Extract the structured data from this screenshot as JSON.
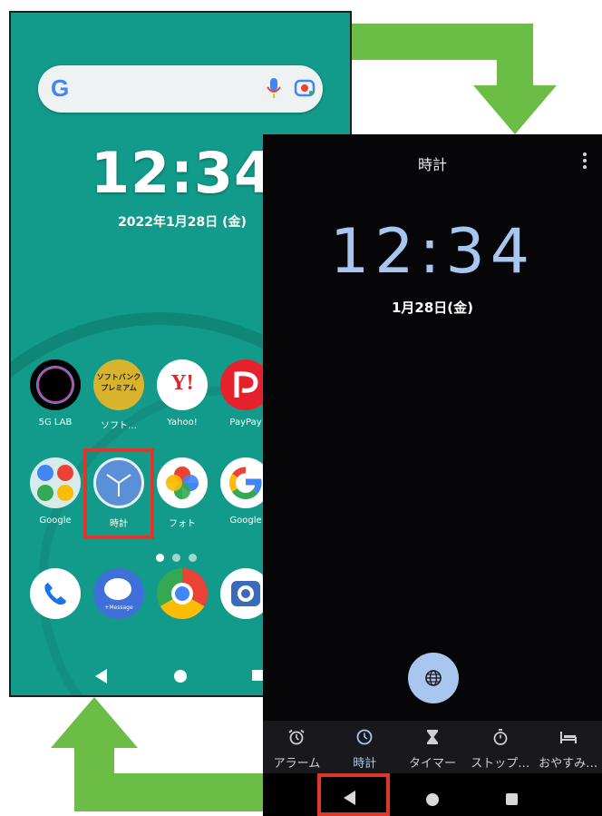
{
  "home_screen": {
    "time": "12:34",
    "date": "2022年1月28日 (金)",
    "search_icons": [
      "google-g-icon",
      "microphone-icon",
      "google-lens-icon"
    ],
    "apps": [
      {
        "label": "5G LAB",
        "icon": "5g-lab-icon"
      },
      {
        "label": "ソフト…",
        "icon": "softbank-premium-icon",
        "icon_text": "ソフトバンク\nプレミアム"
      },
      {
        "label": "Yahoo!",
        "icon": "yahoo-icon",
        "icon_text": "Y!"
      },
      {
        "label": "PayPay",
        "icon": "paypay-icon"
      },
      {
        "label": "Google",
        "icon": "google-folder-icon"
      },
      {
        "label": "時計",
        "icon": "clock-icon"
      },
      {
        "label": "フォト",
        "icon": "photos-icon"
      },
      {
        "label": "Google",
        "icon": "google-icon"
      }
    ],
    "dock": [
      {
        "icon": "phone-icon"
      },
      {
        "icon": "message-icon",
        "icon_text": "+Message"
      },
      {
        "icon": "chrome-icon"
      },
      {
        "icon": "camera-icon"
      }
    ],
    "page_indicator": {
      "count": 3,
      "active": 0
    }
  },
  "clock_app": {
    "title": "時計",
    "time": "12:34",
    "date": "1月28日(金)",
    "tabs": [
      {
        "label": "アラーム",
        "icon": "alarm-icon",
        "active": false
      },
      {
        "label": "時計",
        "icon": "clock-icon",
        "active": true
      },
      {
        "label": "タイマー",
        "icon": "hourglass-icon",
        "active": false
      },
      {
        "label": "ストップ…",
        "icon": "stopwatch-icon",
        "active": false
      },
      {
        "label": "おやすみ…",
        "icon": "bed-icon",
        "active": false
      }
    ]
  },
  "colors": {
    "home_bg": "#129b8a",
    "arrow": "#6bbd45",
    "highlight": "#e0352b",
    "clock_accent": "#a8c6ee"
  }
}
